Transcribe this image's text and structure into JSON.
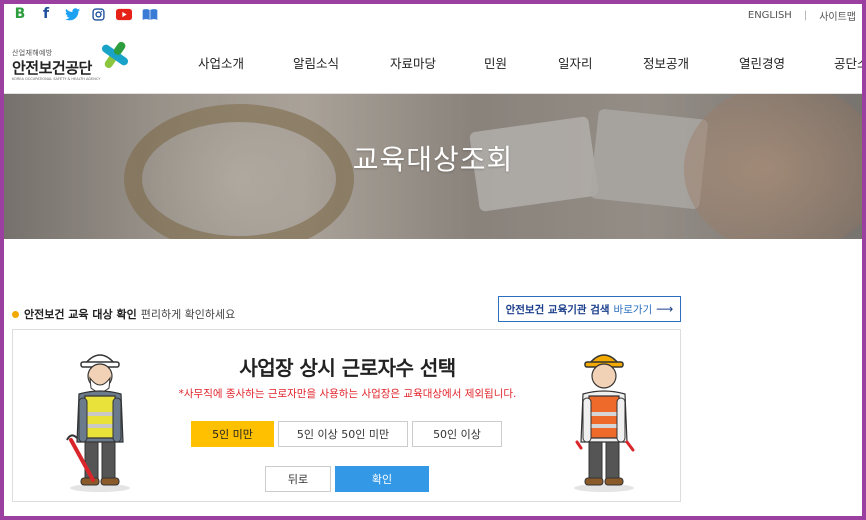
{
  "topbar": {
    "social": [
      "blog-icon",
      "facebook-icon",
      "twitter-icon",
      "instagram-icon",
      "youtube-icon",
      "book-icon"
    ],
    "links": {
      "english": "ENGLISH",
      "sitemap": "사이트맵"
    }
  },
  "header": {
    "logo": {
      "small": "산업재해예방",
      "main": "안전보건공단",
      "eng": "KOREA OCCUPATIONAL SAFETY & HEALTH AGENCY"
    },
    "nav": [
      "사업소개",
      "알림소식",
      "자료마당",
      "민원",
      "일자리",
      "정보공개",
      "열린경영",
      "공단소"
    ]
  },
  "hero": {
    "title": "교육대상조회"
  },
  "intro": {
    "bold": "안전보건 교육 대상 확인",
    "rest": "편리하게 확인하세요"
  },
  "search_link": {
    "bold": "안전보건 교육기관 검색",
    "go": "바로가기",
    "arrow": "⟶"
  },
  "panel": {
    "title": "사업장 상시 근로자수 선택",
    "note": "*사무직에 종사하는 근로자만을 사용하는 사업장은 교육대상에서 제외됩니다.",
    "options": [
      "5인 미만",
      "5인 이상 50인 미만",
      "50인 이상"
    ],
    "selected": "5인 미만",
    "back": "뒤로",
    "confirm": "확인"
  },
  "colors": {
    "accent": "#ffc000",
    "primary": "#3399e6",
    "note": "#e0242a",
    "link": "#2c6fbf"
  }
}
